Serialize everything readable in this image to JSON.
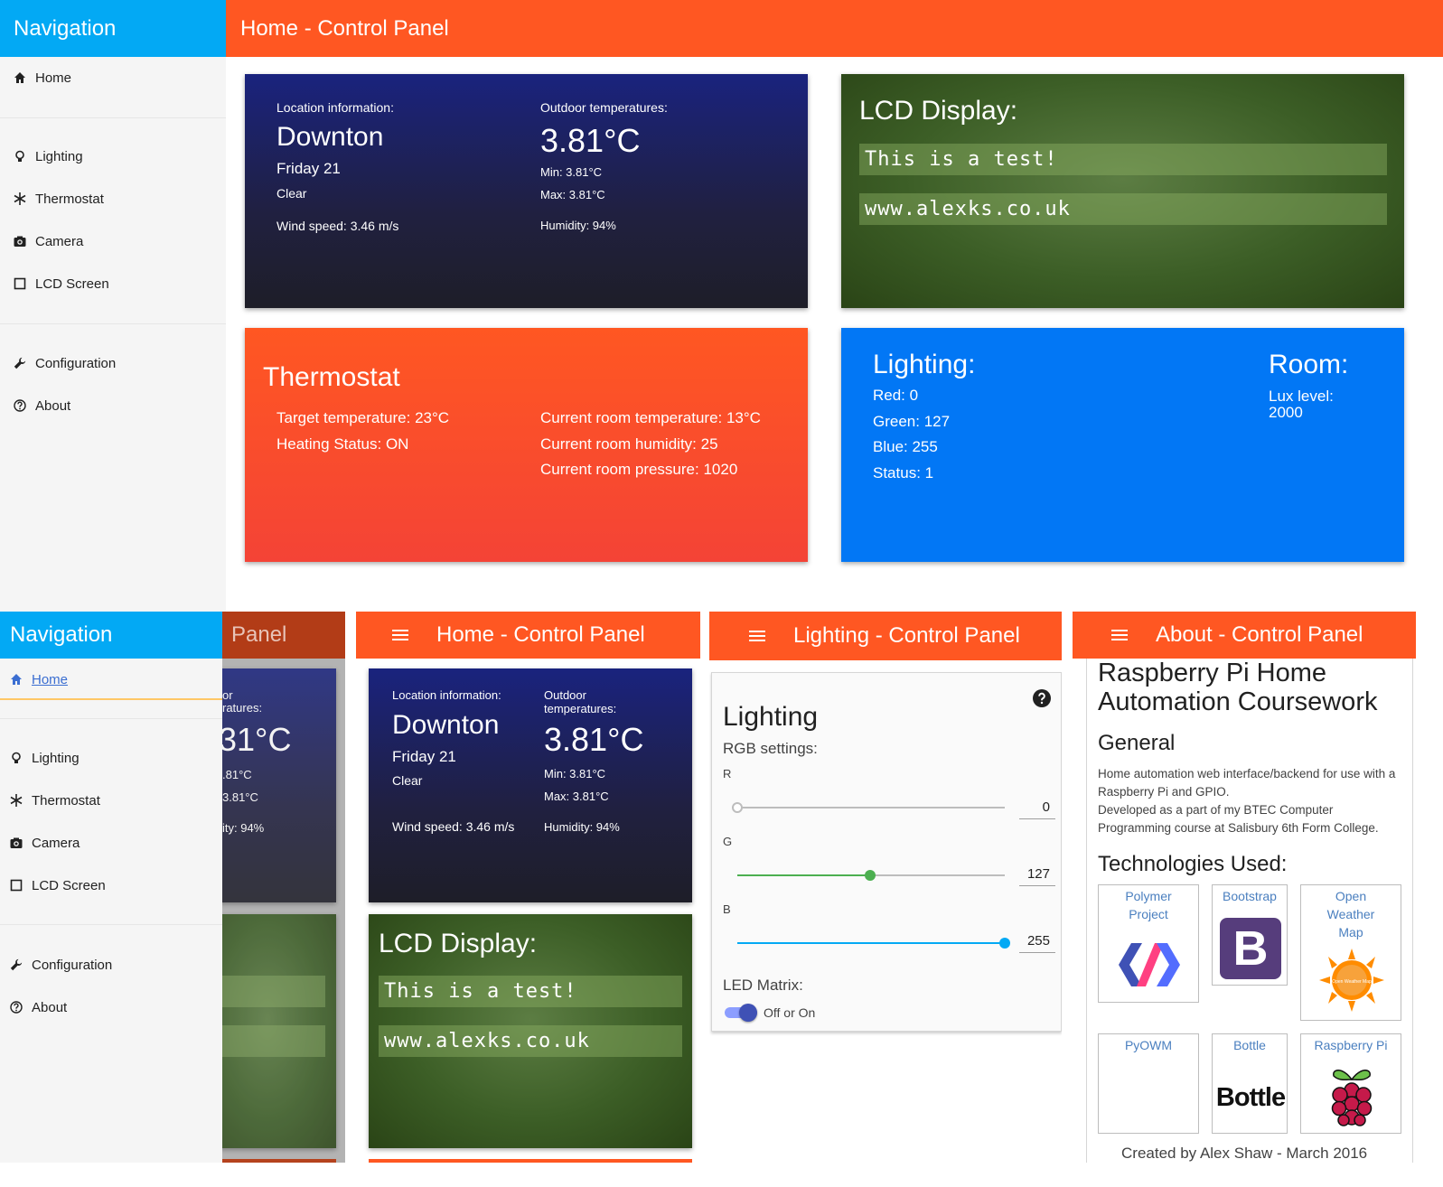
{
  "desktop": {
    "nav_title": "Navigation",
    "header_title": "Home - Control Panel",
    "nav_items": [
      {
        "label": "Home",
        "icon": "home-icon"
      },
      {
        "label": "Lighting",
        "icon": "lightbulb-icon"
      },
      {
        "label": "Thermostat",
        "icon": "snowflake-icon"
      },
      {
        "label": "Camera",
        "icon": "camera-icon"
      },
      {
        "label": "LCD Screen",
        "icon": "square-icon"
      },
      {
        "label": "Configuration",
        "icon": "wrench-icon"
      },
      {
        "label": "About",
        "icon": "help-icon"
      }
    ]
  },
  "weather": {
    "location_label": "Location information:",
    "city": "Downton",
    "day": "Friday 21",
    "condition": "Clear",
    "wind": "Wind speed: 3.46 m/s",
    "outdoor_label": "Outdoor temperatures:",
    "outdoor_label_wrapped": "Outdoor\ntemperatures:",
    "temp": "3.81°C",
    "min": "Min: 3.81°C",
    "max": "Max: 3.81°C",
    "humidity": "Humidity: 94%"
  },
  "lcd": {
    "title": "LCD Display:",
    "line1": "This is a test!",
    "line2": "www.alexks.co.uk"
  },
  "thermostat": {
    "title": "Thermostat",
    "target": "Target temperature: 23°C",
    "heating": "Heating Status: ON",
    "room_temp": "Current room temperature: 13°C",
    "room_humidity": "Current room humidity: 25",
    "room_pressure": "Current room pressure: 1020"
  },
  "lighting_card": {
    "title": "Lighting:",
    "red": "Red: 0",
    "green": "Green: 127",
    "blue": "Blue: 255",
    "status": "Status: 1",
    "room_title": "Room:",
    "lux_label": "Lux level:",
    "lux_value": "2000"
  },
  "mobile_nav": {
    "title": "Navigation",
    "behind_title": "Panel",
    "behind_outdoor_1": "or",
    "behind_outdoor_2": "ratures:",
    "behind_temp": "31°C",
    "behind_min": ".81°C",
    "behind_max": "3.81°C",
    "behind_humidity": "ity: 94%"
  },
  "mobile_home": {
    "title": "Home - Control Panel"
  },
  "mobile_lighting": {
    "title": "Lighting - Control Panel",
    "card_title": "Lighting",
    "rgb_label": "RGB settings:",
    "r_label": "R",
    "g_label": "G",
    "b_label": "B",
    "r_value": "0",
    "g_value": "127",
    "b_value": "255",
    "r_fraction": 0.0,
    "g_fraction": 0.498,
    "b_fraction": 1.0,
    "led_label": "LED Matrix:",
    "toggle_label": "Off or On",
    "toggle_on": true
  },
  "mobile_about": {
    "title": "About - Control Panel",
    "heading": "Raspberry Pi Home Automation Coursework",
    "general_title": "General",
    "general_text_1": "Home automation web interface/backend for use with a Raspberry Pi and GPIO.",
    "general_text_2": "Developed as a part of my BTEC Computer Programming course at Salisbury 6th Form College.",
    "tech_title": "Technologies Used:",
    "tech": [
      {
        "name": "Polymer Project",
        "logo": "polymer-logo"
      },
      {
        "name": "Bootstrap",
        "logo": "bootstrap-logo"
      },
      {
        "name": "Open Weather Map",
        "logo": "openweathermap-logo"
      },
      {
        "name": "PyOWM",
        "logo": ""
      },
      {
        "name": "Bottle",
        "logo": "bottle-logo"
      },
      {
        "name": "Raspberry Pi",
        "logo": "raspberry-pi-logo"
      }
    ],
    "bootstrap_letter": "B",
    "bottle_wordmark": "Bottle",
    "owm_logo_text": "Open Weather Map",
    "footer": "Created by Alex Shaw - March 2016"
  },
  "colors": {
    "nav_blue": "#03a9f4",
    "header_orange": "#ff5722",
    "lighting_blue": "#0277f5",
    "slider_green": "#4caf50",
    "slider_blue": "#03a9f4",
    "toggle_indigo": "#3f51b5"
  }
}
